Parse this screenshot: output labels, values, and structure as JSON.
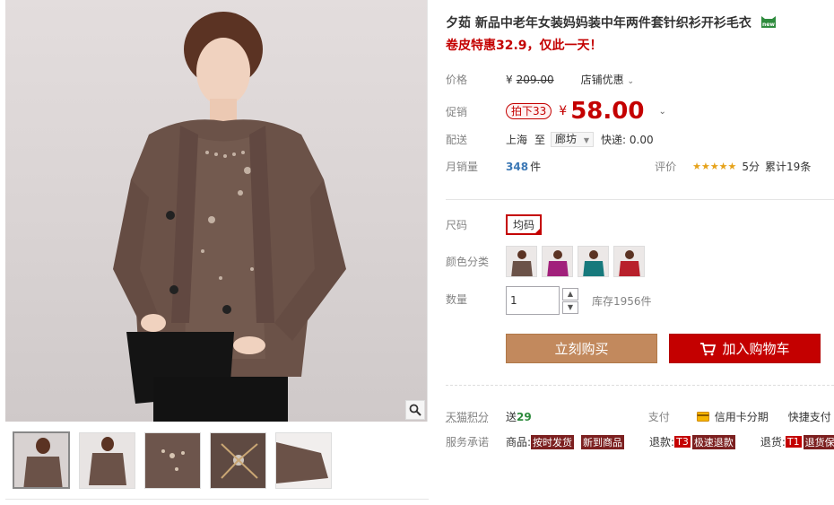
{
  "product": {
    "title": "夕茹 新品中老年女装妈妈装中年两件套针织衫开衫毛衣",
    "new_badge": "new",
    "subtitle": "卷皮特惠32.9，仅此一天！"
  },
  "price": {
    "label": "价格",
    "currency": "¥",
    "original": "209.00",
    "store_discount": "店铺优惠"
  },
  "promo": {
    "label": "促销",
    "tag": "拍下33",
    "currency": "¥",
    "price": "58.00"
  },
  "delivery": {
    "label": "配送",
    "from": "上海",
    "to_word": "至",
    "dest": "廊坊",
    "fee": "快递: 0.00"
  },
  "sales": {
    "label": "月销量",
    "count": "348",
    "unit": "件",
    "rating_label": "评价",
    "stars": "★★★★★",
    "score": "5分",
    "total": "累计19条"
  },
  "size": {
    "label": "尺码",
    "option": "均码"
  },
  "color": {
    "label": "颜色分类",
    "swatches": [
      "brown",
      "magenta",
      "teal",
      "red"
    ]
  },
  "quantity": {
    "label": "数量",
    "value": "1",
    "stock": "库存1956件"
  },
  "buttons": {
    "buy": "立刻购买",
    "cart": "加入购物车"
  },
  "points": {
    "label": "天猫积分",
    "prefix": "送",
    "value": "29",
    "pay_label": "支付",
    "credit": "信用卡分期",
    "express": "快捷支付"
  },
  "service": {
    "label": "服务承诺",
    "goods_prefix": "商品:",
    "tag1": "按时发货",
    "tag2": "新到商品",
    "refund_prefix": "退款:",
    "refund_badge": "T3",
    "refund_text": "极速退款",
    "return_prefix": "退货:",
    "return_badge": "T1",
    "return_text": "退货保"
  },
  "colors": {
    "accent": "#c40000",
    "buy_btn": "#c2895d",
    "sweater": "#6b5248"
  }
}
